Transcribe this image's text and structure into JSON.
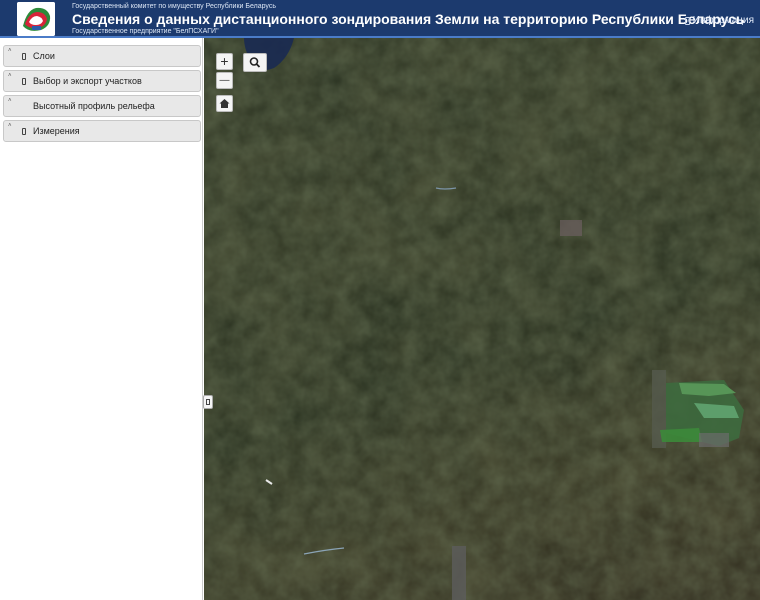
{
  "header": {
    "org": "Государственный комитет по имуществу Республики Беларусь",
    "title": "Сведения о данных дистанционного зондирования Земли на территорию Республики Беларусь",
    "enterprise": "Государственное предприятие \"БелПСХАГИ\"",
    "info_label": "Информация"
  },
  "sidebar": {
    "items": [
      {
        "label": "Слои"
      },
      {
        "label": "Выбор и экспорт участков"
      },
      {
        "label": "Высотный профиль рельефа"
      },
      {
        "label": "Измерения"
      }
    ]
  },
  "map": {
    "zoom_in": "+",
    "zoom_out": "—"
  },
  "colors": {
    "header_bg": "#1c3a6e",
    "accent": "#4b7cc8"
  }
}
